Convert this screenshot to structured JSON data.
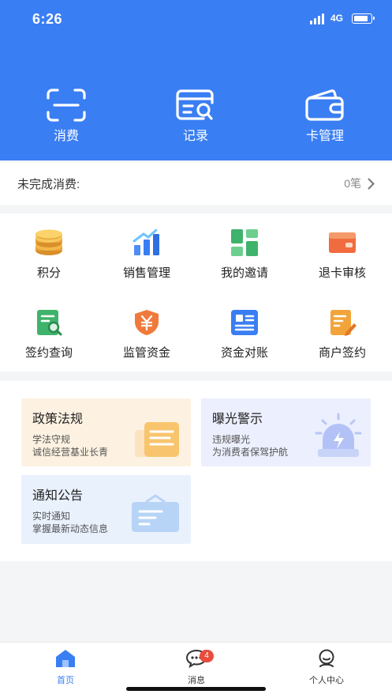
{
  "status_bar": {
    "time": "6:26",
    "network": "4G"
  },
  "quick_actions": [
    {
      "label": "消费",
      "icon": "scan-icon"
    },
    {
      "label": "记录",
      "icon": "record-search-icon"
    },
    {
      "label": "卡管理",
      "icon": "wallet-icon"
    }
  ],
  "pending": {
    "label": "未完成消费:",
    "count": "0笔"
  },
  "grid": [
    {
      "label": "积分",
      "icon": "coins-icon"
    },
    {
      "label": "销售管理",
      "icon": "sales-chart-icon"
    },
    {
      "label": "我的邀请",
      "icon": "invite-grid-icon"
    },
    {
      "label": "退卡审核",
      "icon": "card-return-icon"
    },
    {
      "label": "签约查询",
      "icon": "contract-search-icon"
    },
    {
      "label": "监管资金",
      "icon": "fund-shield-icon"
    },
    {
      "label": "资金对账",
      "icon": "reconcile-icon"
    },
    {
      "label": "商户签约",
      "icon": "merchant-sign-icon"
    }
  ],
  "cards": [
    {
      "title": "政策法规",
      "line1": "学法守规",
      "line2": "诚信经营基业长青",
      "bg": "#fdf2e2"
    },
    {
      "title": "曝光警示",
      "line1": "违规曝光",
      "line2": "为消费者保驾护航",
      "bg": "#eceffd"
    },
    {
      "title": "通知公告",
      "line1": "实时通知",
      "line2": "掌握最新动态信息",
      "bg": "#e9f1fd"
    }
  ],
  "tabbar": {
    "items": [
      {
        "label": "首页",
        "icon": "home-icon",
        "active": true
      },
      {
        "label": "消息",
        "icon": "message-icon",
        "badge": "4"
      },
      {
        "label": "个人中心",
        "icon": "profile-icon"
      }
    ]
  },
  "colors": {
    "primary": "#3a7ef3",
    "badge": "#e74c3c"
  }
}
